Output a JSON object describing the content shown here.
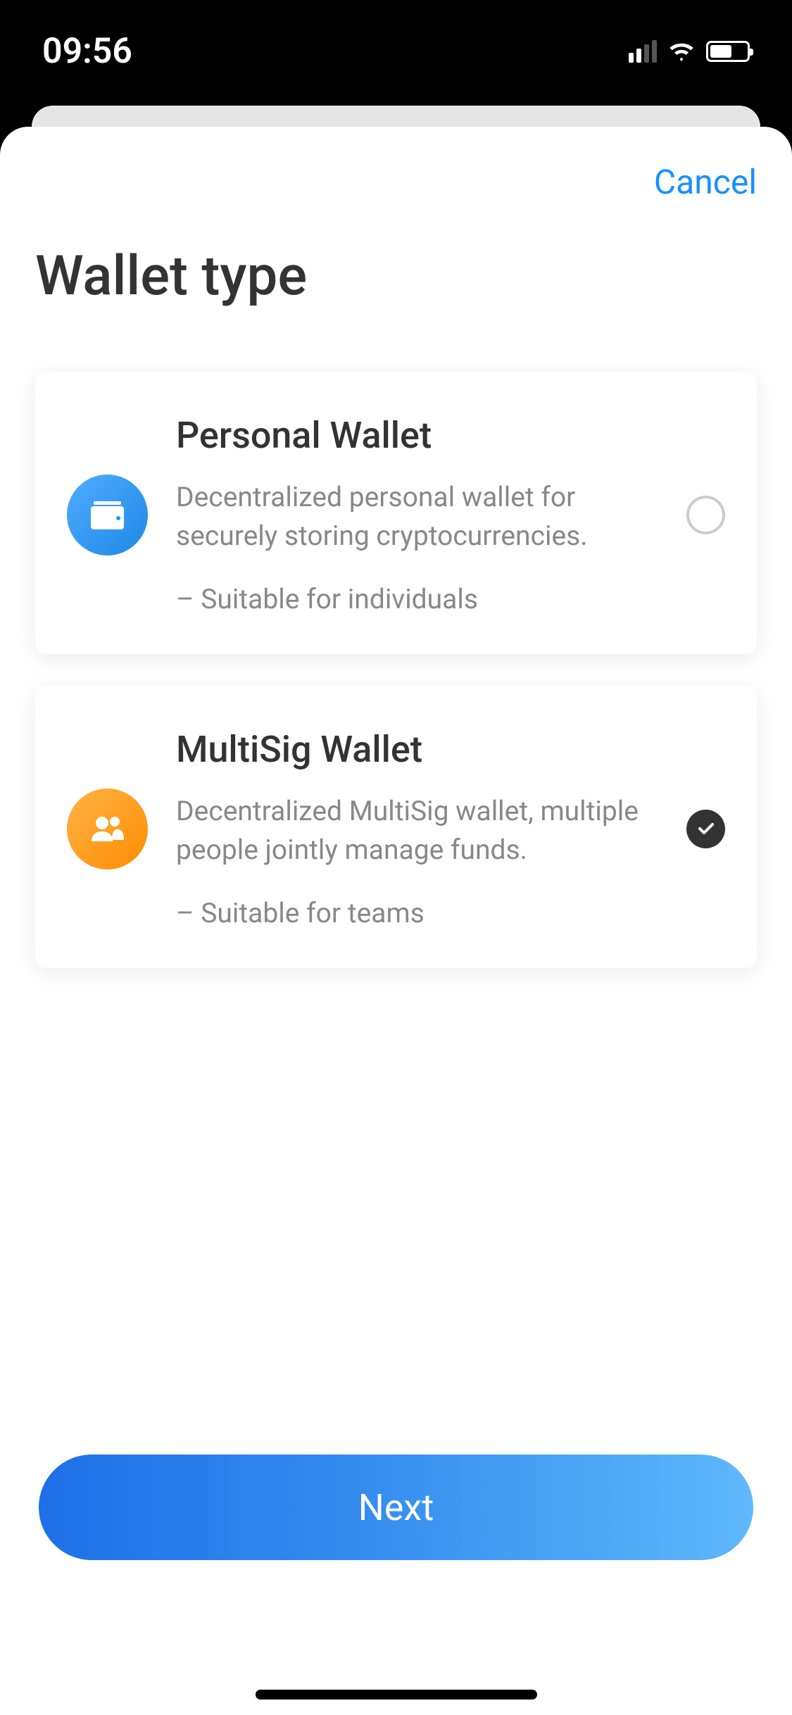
{
  "status": {
    "time": "09:56"
  },
  "header": {
    "cancel_label": "Cancel"
  },
  "page": {
    "title": "Wallet type"
  },
  "options": [
    {
      "title": "Personal Wallet",
      "description": "Decentralized personal wallet for securely storing cryptocurrencies.",
      "suitability": "– Suitable for individuals",
      "icon": "wallet-icon",
      "selected": false
    },
    {
      "title": "MultiSig Wallet",
      "description": "Decentralized MultiSig wallet, multiple people jointly manage funds.",
      "suitability": "– Suitable for teams",
      "icon": "people-icon",
      "selected": true
    }
  ],
  "footer": {
    "next_label": "Next"
  }
}
